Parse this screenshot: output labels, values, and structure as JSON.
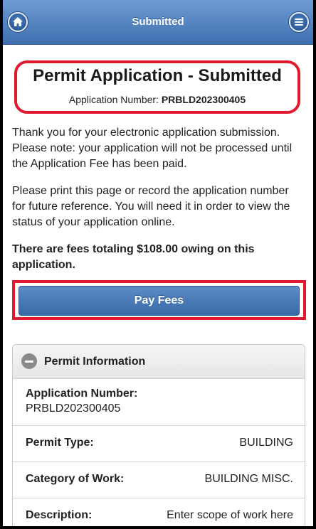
{
  "header": {
    "title": "Submitted",
    "home_icon": "home-icon",
    "menu_icon": "menu-icon"
  },
  "heading": {
    "title": "Permit Application - Submitted",
    "app_number_label": "Application Number:",
    "app_number": "PRBLD202300405"
  },
  "messages": {
    "p1": "Thank you for your electronic application submission. Please note: your application will not be processed until the Application Fee has been paid.",
    "p2": "Please print this page or record the application number for future reference. You will need it in order to view the status of your application online.",
    "fees": "There are fees totaling $108.00 owing on this application."
  },
  "pay_button": {
    "label": "Pay Fees"
  },
  "permit_info": {
    "title": "Permit Information",
    "collapse_icon": "minus-circle-icon",
    "rows": [
      {
        "label": "Application Number:",
        "value": "PRBLD202300405"
      },
      {
        "label": "Permit Type:",
        "value": "BUILDING"
      },
      {
        "label": "Category of Work:",
        "value": "BUILDING MISC."
      },
      {
        "label": "Description:",
        "value": "Enter scope of work here"
      }
    ]
  },
  "colors": {
    "header_blue": "#4f7fbf",
    "highlight_red": "#e01b2f",
    "button_blue": "#4a7bb8"
  }
}
